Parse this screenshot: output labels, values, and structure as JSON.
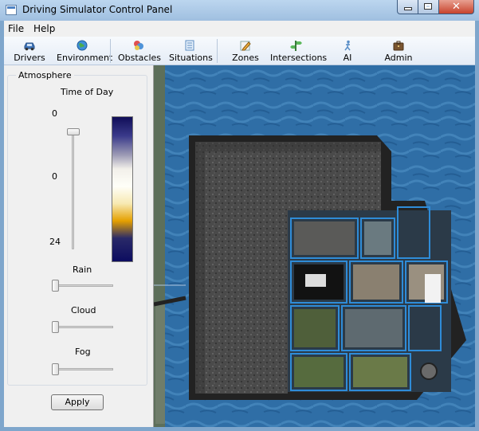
{
  "window": {
    "title": "Driving Simulator Control Panel",
    "close_glyph": "✕"
  },
  "menu": {
    "items": [
      "File",
      "Help"
    ]
  },
  "toolbar": {
    "buttons": [
      {
        "label": "Drivers",
        "icon": "car-icon"
      },
      {
        "label": "Environment",
        "icon": "globe-icon"
      },
      {
        "label": "Obstacles",
        "icon": "obstacles-icon"
      },
      {
        "label": "Situations",
        "icon": "document-icon"
      },
      {
        "label": "Zones",
        "icon": "pencil-icon"
      },
      {
        "label": "Intersections",
        "icon": "signpost-icon"
      },
      {
        "label": "AI",
        "icon": "figure-icon"
      },
      {
        "label": "Admin",
        "icon": "briefcase-icon"
      }
    ]
  },
  "atmosphere": {
    "group_title": "Atmosphere",
    "time_of_day": {
      "label": "Time of Day",
      "top_label": "0",
      "current_label": "0",
      "bottom_label": "24",
      "value": 0
    },
    "rain": {
      "label": "Rain",
      "value": 0
    },
    "cloud": {
      "label": "Cloud",
      "value": 0
    },
    "fog": {
      "label": "Fog",
      "value": 0
    },
    "apply_label": "Apply"
  },
  "colors": {
    "water": "#2f6ea6",
    "window_frame": "#9fbfe0",
    "panel_bg": "#f0f0f0",
    "close_button": "#c7432c"
  }
}
